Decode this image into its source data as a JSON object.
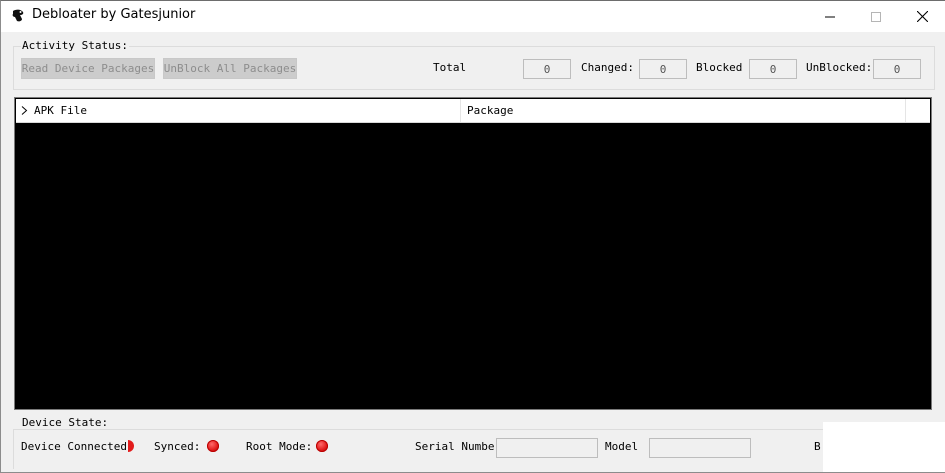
{
  "window": {
    "title": "Debloater by Gatesjunior",
    "controls": [
      "minimize",
      "maximize",
      "close"
    ]
  },
  "activity": {
    "label": "Activity Status:",
    "buttons": {
      "read": "Read Device Packages",
      "unblock_all": "UnBlock All Packages"
    },
    "counters": [
      {
        "label": "Total",
        "value": "0"
      },
      {
        "label": "Changed:",
        "value": "0"
      },
      {
        "label": "Blocked",
        "value": "0"
      },
      {
        "label": "UnBlocked:",
        "value": "0"
      }
    ]
  },
  "list": {
    "columns": [
      "APK File",
      "Package"
    ],
    "expand_icon": "chevron-right-icon"
  },
  "device": {
    "label": "Device State:",
    "connected_label": "Device Connected:",
    "synced_label": "Synced:",
    "root_label": "Root Mode:",
    "serial_label": "Serial Number:",
    "serial_value": "",
    "model_label": "Model",
    "model_value": "",
    "clipped_label": "B",
    "status_color": "#e21b1b"
  }
}
